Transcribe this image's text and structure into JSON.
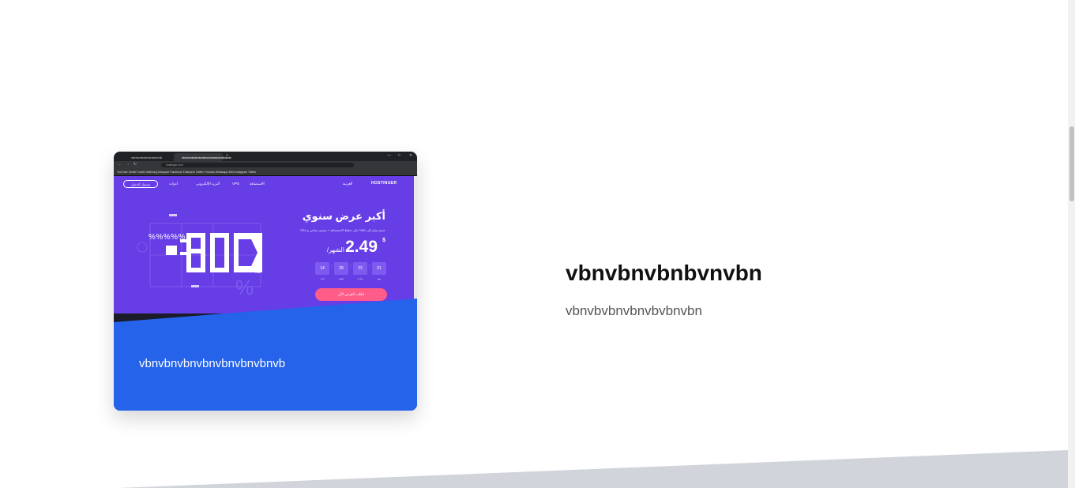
{
  "card": {
    "caption": "vbnvbnvbnvbnvbnvbnvbnvb",
    "screenshot": {
      "tabs": [
        "vbnbvnbvbnbvnbvbnb",
        "vbnbvnbvbnbvnbvnbvbnbvbnbvbnb"
      ],
      "url": "hostinger.com",
      "bookmarks": "YouTube   Gmail   Tumblr   Nathmeg   Dotspace   Facebook   Followers   Twitter Threads   Whatsapp Web   Instagram   Twitter",
      "login_label": "تسجيل الدخول",
      "nav_items": [
        "الاستضافة",
        "VPS",
        "البريد الإلكتروني",
        "أدوات"
      ],
      "language": "العربية",
      "brand": "HOSTINGER",
      "hero_title": "أكبر عرض سنوي",
      "hero_subtitle": "خصم يصل إلى 80% على خطط الاستضافة + دومين مجاني و SSL",
      "price": "2.49",
      "currency": "$",
      "price_unit": "/الشهر",
      "countdown": [
        {
          "value": "14",
          "label": "ثانية"
        },
        {
          "value": "28",
          "label": "دقيقة"
        },
        {
          "value": "23",
          "label": "ساعة"
        },
        {
          "value": "01",
          "label": "يوم"
        }
      ],
      "cta_label": "اطلب العرض الآن",
      "percent_signs": "%%%%%",
      "big_number": "-80",
      "big_number_suffix": "%"
    }
  },
  "content": {
    "title": "vbnvbnvbnbvnvbn",
    "subtitle": "vbnvbvbnvbnvbvbnvbn"
  },
  "colors": {
    "card_blue": "#2563eb",
    "hostinger_purple": "#673de6",
    "cta_pink": "#ff5c89",
    "bottom_band": "#d1d5db"
  }
}
